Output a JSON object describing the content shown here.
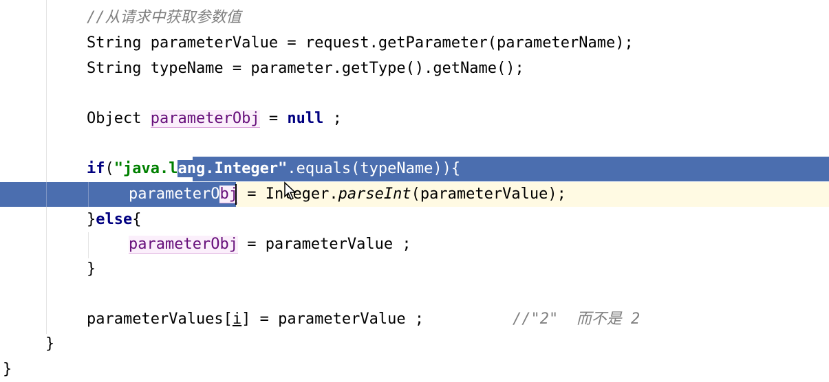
{
  "editor": {
    "lines": {
      "comment1": "//从请求中获取参数值",
      "l_param_value": {
        "a": "String parameterValue = request.getParameter(parameterName);"
      },
      "l_type_name": {
        "a": "String typeName = parameter.getType().getName();"
      },
      "l_obj": {
        "type": "Object ",
        "var": "parameterObj",
        "eq": " = ",
        "kw_null": "null",
        "end": " ;"
      },
      "l_if": {
        "kw_if": "if",
        "paren": "(",
        "str_a": "\"java.l",
        "str_b": "ang.Integer\"",
        "rest": ".equals(typeName)){"
      },
      "l_assign1": {
        "var_a": "parameterO",
        "var_b": "bj",
        "eq": " = ",
        "cls": "Integer.",
        "method": "parseInt",
        "rest": "(parameterValue);"
      },
      "l_else": {
        "brace": "}",
        "kw_else": "else",
        "open": "{"
      },
      "l_assign2": {
        "var": "parameterObj",
        "rest": " = parameterValue ;"
      },
      "l_close1": "}",
      "l_values": {
        "a": "parameterValues[",
        "i": "i",
        "b": "] = parameterValue ;",
        "comment": "//\"2\"  而不是 2"
      },
      "l_close2": "}",
      "l_close3": "}"
    },
    "colors": {
      "selection": "#4b6eaf",
      "caret_row": "#fffae3",
      "keyword": "#000080",
      "string": "#008000",
      "field": "#660e7a",
      "comment": "#808080"
    }
  }
}
